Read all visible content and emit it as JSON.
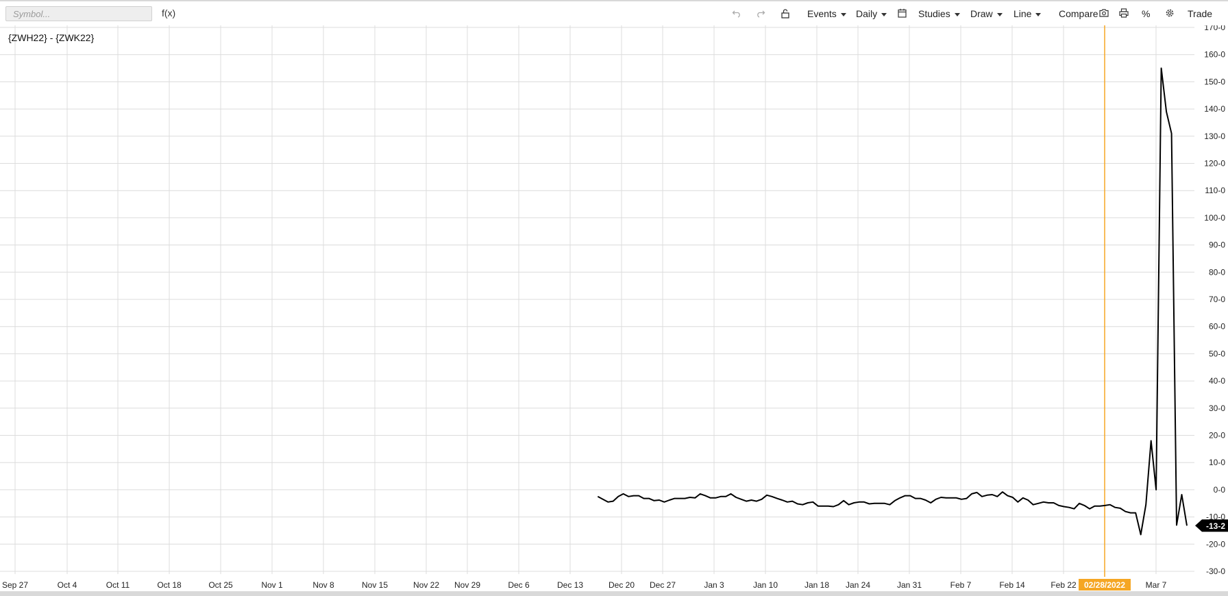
{
  "toolbar": {
    "symbol_placeholder": "Symbol...",
    "fx_label": "f(x)",
    "events_label": "Events",
    "daily_label": "Daily",
    "studies_label": "Studies",
    "draw_label": "Draw",
    "line_label": "Line",
    "compare_label": "Compare",
    "percent_label": "%",
    "trade_label": "Trade",
    "icons": [
      "undo-icon",
      "redo-icon",
      "lock-icon",
      "calendar-icon",
      "camera-icon",
      "print-icon",
      "gear-icon"
    ]
  },
  "colors": {
    "line": "#000000",
    "crosshair": "#f5a623",
    "grid": "#dcdcdc",
    "price_flag_bg": "#000000"
  },
  "chart_data": {
    "type": "line",
    "title": "{ZWH22} - {ZWK22}",
    "xlabel": "",
    "ylabel": "",
    "ylim": [
      -30,
      170
    ],
    "y_ticks": [
      {
        "value": 170,
        "label": "170-0"
      },
      {
        "value": 160,
        "label": "160-0"
      },
      {
        "value": 150,
        "label": "150-0"
      },
      {
        "value": 140,
        "label": "140-0"
      },
      {
        "value": 130,
        "label": "130-0"
      },
      {
        "value": 120,
        "label": "120-0"
      },
      {
        "value": 110,
        "label": "110-0"
      },
      {
        "value": 100,
        "label": "100-0"
      },
      {
        "value": 90,
        "label": "90-0"
      },
      {
        "value": 80,
        "label": "80-0"
      },
      {
        "value": 70,
        "label": "70-0"
      },
      {
        "value": 60,
        "label": "60-0"
      },
      {
        "value": 50,
        "label": "50-0"
      },
      {
        "value": 40,
        "label": "40-0"
      },
      {
        "value": 30,
        "label": "30-0"
      },
      {
        "value": 20,
        "label": "20-0"
      },
      {
        "value": 10,
        "label": "10-0"
      },
      {
        "value": 0,
        "label": "0-0"
      },
      {
        "value": -10,
        "label": "-10-0"
      },
      {
        "value": -20,
        "label": "-20-0"
      },
      {
        "value": -30,
        "label": "-30-0"
      }
    ],
    "x_ticks": [
      "Sep 27",
      "Oct 4",
      "Oct 11",
      "Oct 18",
      "Oct 25",
      "Nov 1",
      "Nov 8",
      "Nov 15",
      "Nov 22",
      "Nov 29",
      "Dec 6",
      "Dec 13",
      "Dec 20",
      "Dec 27",
      "Jan 3",
      "Jan 10",
      "Jan 18",
      "Jan 24",
      "Jan 31",
      "Feb 7",
      "Feb 14",
      "Feb 22",
      "Mar 7"
    ],
    "crosshair_date": "02/28/2022",
    "last_value_label": "-13-2",
    "grid": true,
    "series": [
      {
        "values": [
          -2.5,
          -3.5,
          -4.5,
          -4.2,
          -2.5,
          -1.5,
          -2.5,
          -2.2,
          -2.2,
          -3.2,
          -3.2,
          -4.0,
          -3.8,
          -4.5,
          -3.8,
          -3.2,
          -3.2,
          -3.2,
          -2.8,
          -3.0,
          -1.5,
          -2.2,
          -3.0,
          -3.0,
          -2.5,
          -2.5,
          -1.5,
          -2.8,
          -3.5,
          -4.2,
          -3.8,
          -4.2,
          -3.5,
          -2.0,
          -2.5,
          -3.2,
          -3.8,
          -4.5,
          -4.2,
          -5.2,
          -5.5,
          -4.8,
          -4.5,
          -6.0,
          -6.0,
          -6.0,
          -6.2,
          -5.5,
          -4.0,
          -5.5,
          -4.8,
          -4.5,
          -4.5,
          -5.2,
          -5.0,
          -5.0,
          -5.0,
          -5.5,
          -4.0,
          -3.0,
          -2.2,
          -2.2,
          -3.2,
          -3.2,
          -3.8,
          -4.8,
          -3.5,
          -2.8,
          -3.0,
          -3.0,
          -3.0,
          -3.5,
          -3.2,
          -1.5,
          -1.0,
          -2.5,
          -2.0,
          -1.8,
          -2.5,
          -0.8,
          -2.2,
          -2.8,
          -4.5,
          -3.0,
          -3.8,
          -5.5,
          -5.0,
          -4.5,
          -4.8,
          -4.8,
          -5.8,
          -6.2,
          -6.5,
          -7.0,
          -5.0,
          -5.8,
          -7.0,
          -6.0,
          -6.0,
          -5.8,
          -5.5,
          -6.5,
          -6.8,
          -8.0,
          -8.5,
          -8.5,
          -16.5,
          -5.5,
          18.0,
          0.0,
          155.0,
          139.0,
          131.0,
          -13.0,
          -1.8,
          -13.2
        ]
      }
    ]
  }
}
